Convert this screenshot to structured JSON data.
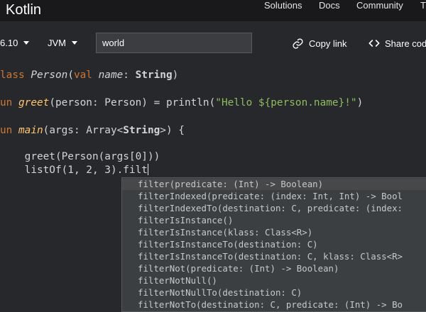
{
  "topnav": {
    "brand": "Kotlin",
    "links": [
      "Solutions",
      "Docs",
      "Community",
      "T"
    ]
  },
  "toolbar": {
    "version": "6.10",
    "platform": "JVM",
    "program_args": "world",
    "copy_link": "Copy link",
    "share_code": "Share cod",
    "icons": [
      "link-icon",
      "code-icon"
    ]
  },
  "editor": {
    "line1": {
      "t1": "lass ",
      "t2": "Person",
      "t3": "(",
      "t4": "val ",
      "t5": "name",
      "t6": ": ",
      "t7": "String",
      "t8": ")"
    },
    "line2": {
      "t1": "un ",
      "t2": "greet",
      "t3": "(person: Person) = ",
      "t4": "println",
      "t5": "(",
      "t6": "\"Hello ${person.name}!\"",
      "t7": ")"
    },
    "line3": {
      "t1": "un ",
      "t2": "main",
      "t3": "(args: Array<",
      "t4": "String",
      "t5": ">) {"
    },
    "line4": {
      "t1": "    ",
      "t2": "greet",
      "t3": "(Person(args[0]))"
    },
    "line5": {
      "t1": "    ",
      "t2": "listOf",
      "t3": "(1, 2, 3).filt"
    }
  },
  "autocomplete": {
    "items": [
      "filter(predicate: (Int) -> Boolean)",
      "filterIndexed(predicate: (index: Int, Int) -> Bool",
      "filterIndexedTo(destination: C, predicate: (index:",
      "filterIsInstance()",
      "filterIsInstance(klass: Class<R>)",
      "filterIsInstanceTo(destination: C)",
      "filterIsInstanceTo(destination: C, klass: Class<R>",
      "filterNot(predicate: (Int) -> Boolean)",
      "filterNotNull()",
      "filterNotNullTo(destination: C)",
      "filterNotTo(destination: C, predicate: (Int) -> Bo"
    ],
    "selected_index": 0
  },
  "colors": {
    "keyword": "#cc7832",
    "function": "#ffc66d",
    "string": "#8fbc5f",
    "background": "#27282c",
    "navbar": "#19191c",
    "popup": "#3c3f41"
  }
}
